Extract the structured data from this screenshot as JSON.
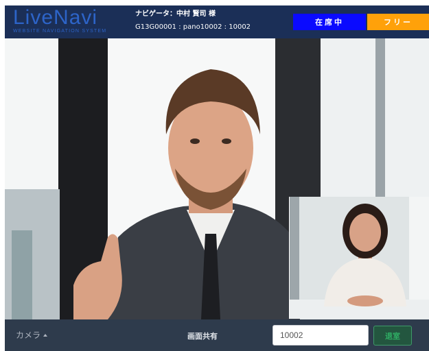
{
  "header": {
    "logo_main": "LiveNavi",
    "logo_sub": "WEBSITE NAVIGATION SYSTEM",
    "navigator_name": "ナビゲータ：中村 賢司 様",
    "navigator_ids": "G13G00001 : pano10002 : 10002",
    "status_online": "在席中",
    "status_free": "フリー"
  },
  "bottom_bar": {
    "camera_label": "カメラ",
    "screen_share_label": "画面共有",
    "room_input_value": "10002",
    "enter_label": "退室"
  },
  "colors": {
    "header_bg": "#1b2f57",
    "logo": "#2d64c8",
    "status_online_bg": "#0a0aff",
    "status_free_bg": "#ffa10a",
    "bottom_bar_bg": "#2e3b4c",
    "enter_button_text": "#2fae64"
  }
}
